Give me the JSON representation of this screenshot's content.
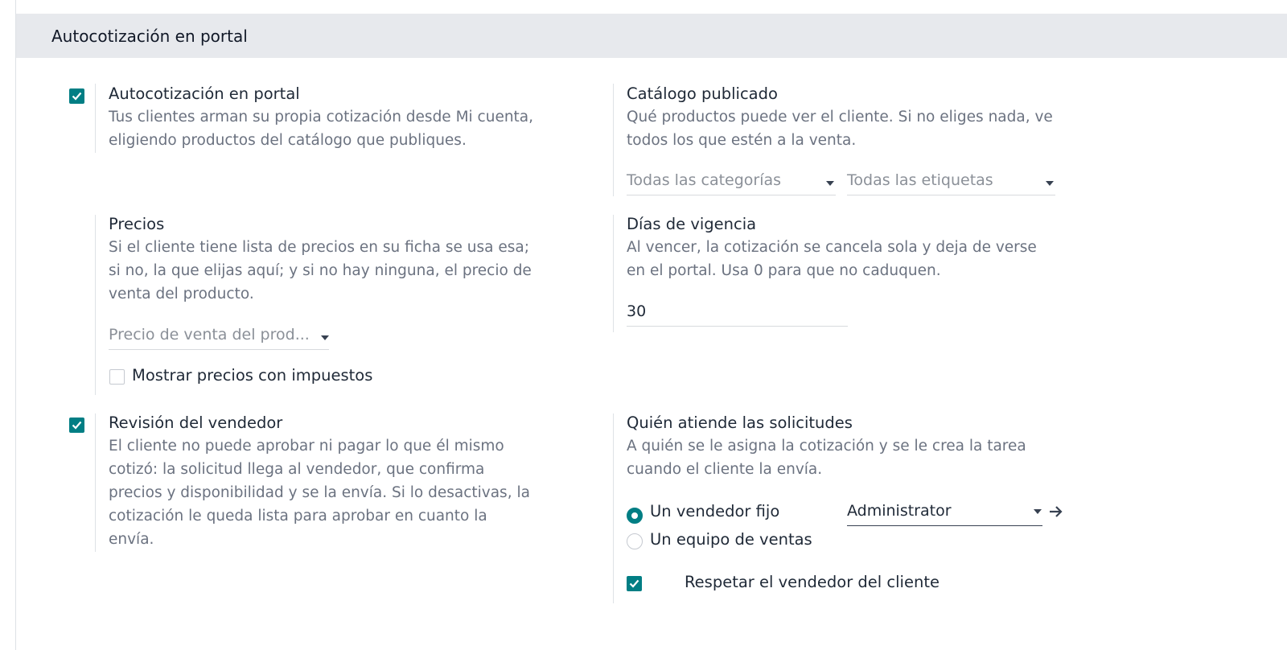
{
  "section": {
    "title": "Autocotización en portal"
  },
  "portal": {
    "checked": true,
    "title": "Autocotización en portal",
    "desc": [
      "Tus clientes arman su propia cotización desde Mi cuenta,",
      "eligiendo productos del catálogo que publiques."
    ]
  },
  "catalog": {
    "title": "Catálogo publicado",
    "desc": [
      "Qué productos puede ver el cliente. Si no eliges nada, ve",
      "todos los que estén a la venta."
    ],
    "categories_placeholder": "Todas las categorías",
    "tags_placeholder": "Todas las etiquetas"
  },
  "prices": {
    "title": "Precios",
    "desc": [
      "Si el cliente tiene lista de precios en su ficha se usa esa;",
      "si no, la que elijas aquí; y si no hay ninguna, el precio de",
      "venta del producto."
    ],
    "pricelist_value": "Precio de venta del prod...",
    "tax_label": "Mostrar precios con impuestos",
    "tax_checked": false
  },
  "validity": {
    "title": "Días de vigencia",
    "desc": [
      "Al vencer, la cotización se cancela sola y deja de verse",
      "en el portal. Usa 0 para que no caduquen."
    ],
    "days": "30"
  },
  "review": {
    "checked": true,
    "title": "Revisión del vendedor",
    "desc": [
      "El cliente no puede aprobar ni pagar lo que él mismo",
      "cotizó: la solicitud llega al vendedor, que confirma",
      "precios y disponibilidad y se la envía. Si lo desactivas, la",
      "cotización le queda lista para aprobar en cuanto la",
      "envía."
    ]
  },
  "assign": {
    "title": "Quién atiende las solicitudes",
    "desc": [
      "A quién se le asigna la cotización y se le crea la tarea",
      "cuando el cliente la envía."
    ],
    "option_fixed": "Un vendedor fijo",
    "option_team": "Un equipo de ventas",
    "selected": "fixed",
    "salesperson": "Administrator",
    "respect_label": "Respetar el vendedor del cliente",
    "respect_checked": true
  },
  "colors": {
    "accent": "#017e84",
    "header_bg": "#e7e9ed"
  }
}
